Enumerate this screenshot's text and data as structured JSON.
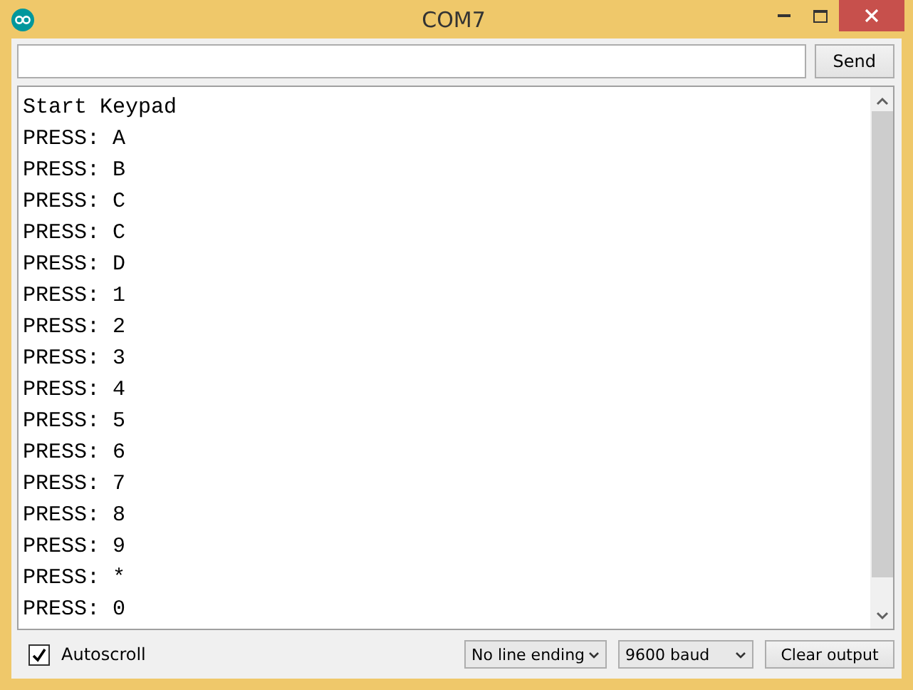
{
  "window": {
    "title": "COM7"
  },
  "send_button": "Send",
  "output_lines": [
    "Start Keypad",
    "PRESS: A",
    "PRESS: B",
    "PRESS: C",
    "PRESS: C",
    "PRESS: D",
    "PRESS: 1",
    "PRESS: 2",
    "PRESS: 3",
    "PRESS: 4",
    "PRESS: 5",
    "PRESS: 6",
    "PRESS: 7",
    "PRESS: 8",
    "PRESS: 9",
    "PRESS: *",
    "PRESS: 0"
  ],
  "autoscroll": {
    "label": "Autoscroll",
    "checked": true
  },
  "line_ending": "No line ending",
  "baud": "9600 baud",
  "clear_button": "Clear output"
}
